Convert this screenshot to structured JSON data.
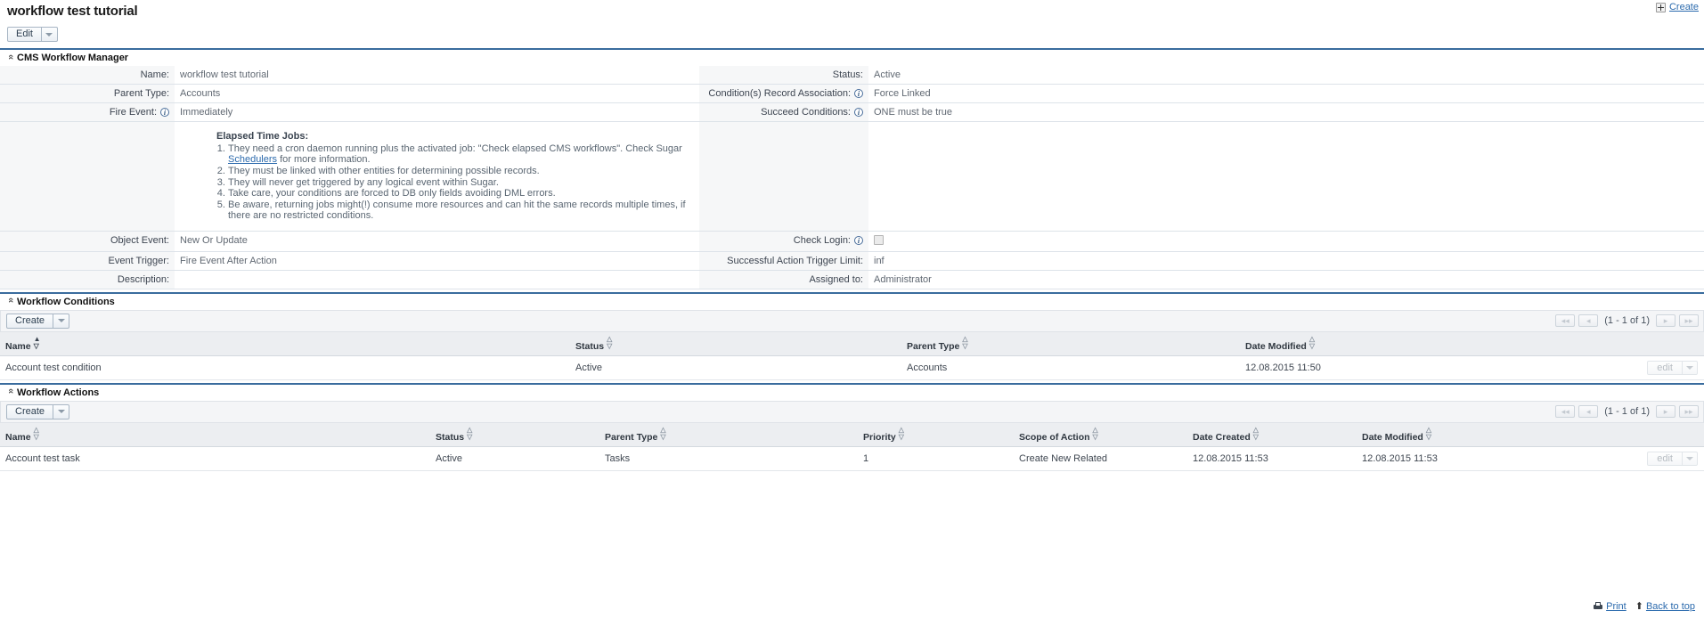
{
  "header": {
    "record_title": "workflow test tutorial",
    "create_label": "Create",
    "create_icon": "plus-icon"
  },
  "actions": {
    "edit_label": "Edit",
    "dropdown_icon": "chevron-down-icon"
  },
  "detail_panel": {
    "title": "CMS Workflow Manager",
    "collapse_icon": "chevron-up-icon",
    "rows": [
      {
        "label": "Name:",
        "value": "workflow test tutorial",
        "info": false
      },
      {
        "label": "Parent Type:",
        "value": "Accounts",
        "info": false
      },
      {
        "label": "Fire Event:",
        "value": "Immediately",
        "info": true
      }
    ],
    "rows_right": [
      {
        "label": "Status:",
        "value": "Active",
        "info": false
      },
      {
        "label": "Condition(s) Record Association:",
        "value": "Force Linked",
        "info": true
      },
      {
        "label": "Succeed Conditions:",
        "value": "ONE must be true",
        "info": true
      }
    ],
    "notice": {
      "title": "Elapsed Time Jobs:",
      "items": [
        "They need a cron daemon running plus the activated job: \"Check elapsed CMS workflows\". Check Sugar Schedulers for more information.",
        "They must be linked with other entities for determining possible records.",
        "They will never get triggered by any logical event within Sugar.",
        "Take care, your conditions are forced to DB only fields avoiding DML errors.",
        "Be aware, returning jobs might(!) consume more resources and can hit the same records multiple times, if there are no restricted conditions."
      ],
      "item1_part1": "They need a cron daemon running plus the activated job: \"Check elapsed CMS workflows\". Check Sugar ",
      "item1_link": "Schedulers",
      "item1_part2": " for more information."
    },
    "rows_bottom": [
      {
        "label": "Object Event:",
        "value": "New Or Update",
        "info": false
      },
      {
        "label": "Event Trigger:",
        "value": "Fire Event After Action",
        "info": false
      },
      {
        "label": "Description:",
        "value": "",
        "info": false
      }
    ],
    "rows_bottom_right": [
      {
        "label": "Check Login:",
        "value": "",
        "info": true,
        "checkbox": true,
        "checked": false
      },
      {
        "label": "Successful Action Trigger Limit:",
        "value": "inf",
        "info": false
      },
      {
        "label": "Assigned to:",
        "value": "Administrator",
        "info": false
      }
    ]
  },
  "conditions_panel": {
    "title": "Workflow Conditions",
    "collapse_icon": "chevron-up-icon",
    "create_label": "Create",
    "pager": {
      "first_icon": "first-page-icon",
      "prev_icon": "prev-page-icon",
      "count": "(1 - 1 of 1)",
      "next_icon": "next-page-icon",
      "last_icon": "last-page-icon"
    },
    "columns": [
      "Name",
      "Status",
      "Parent Type",
      "Date Modified"
    ],
    "sorted_column": "Name",
    "rows": [
      {
        "name": "Account test condition",
        "status": "Active",
        "parent_type": "Accounts",
        "date_modified": "12.08.2015 11:50",
        "edit_label": "edit"
      }
    ]
  },
  "actions_panel": {
    "title": "Workflow Actions",
    "collapse_icon": "chevron-up-icon",
    "create_label": "Create",
    "pager": {
      "first_icon": "first-page-icon",
      "prev_icon": "prev-page-icon",
      "count": "(1 - 1 of 1)",
      "next_icon": "next-page-icon",
      "last_icon": "last-page-icon"
    },
    "columns": [
      "Name",
      "Status",
      "Parent Type",
      "Priority",
      "Scope of Action",
      "Date Created",
      "Date Modified"
    ],
    "rows": [
      {
        "name": "Account test task",
        "status": "Active",
        "parent_type": "Tasks",
        "priority": "1",
        "scope": "Create New Related",
        "date_created": "12.08.2015 11:53",
        "date_modified": "12.08.2015 11:53",
        "edit_label": "edit"
      }
    ]
  },
  "footer": {
    "print_label": "Print",
    "print_icon": "printer-icon",
    "back_to_top_label": "Back to top",
    "back_icon": "up-arrow-icon"
  },
  "colors": {
    "accent_rule": "#3a6c9e",
    "link": "#2b6aad",
    "label_bg": "#f6f7f8",
    "header_bg": "#eceef1"
  }
}
